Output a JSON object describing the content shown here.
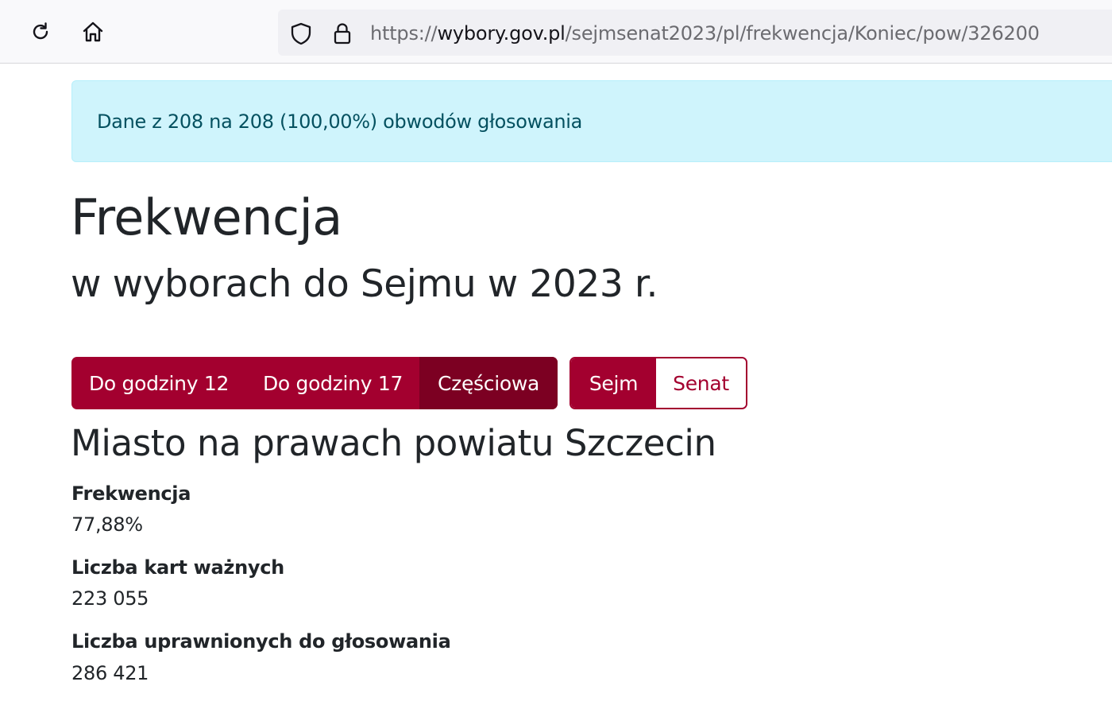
{
  "browser": {
    "url_prefix": "https://",
    "url_domain": "wybory.gov.pl",
    "url_path": "/sejmsenat2023/pl/frekwencja/Koniec/pow/326200",
    "icons": [
      "reload-icon",
      "home-icon",
      "shield-icon",
      "lock-icon"
    ]
  },
  "alert": {
    "text": "Dane z 208 na 208 (100,00%) obwodów głosowania"
  },
  "page": {
    "title": "Frekwencja",
    "subtitle": "w wyborach do Sejmu w 2023 r."
  },
  "time_buttons": [
    {
      "label": "Do godziny 12"
    },
    {
      "label": "Do godziny 17"
    },
    {
      "label": "Częściowa",
      "active": true
    }
  ],
  "chamber_buttons": [
    {
      "label": "Sejm",
      "active": true
    },
    {
      "label": "Senat"
    }
  ],
  "region": {
    "name": "Miasto na prawach powiatu Szczecin"
  },
  "stats": [
    {
      "label": "Frekwencja",
      "value": "77,88%"
    },
    {
      "label": "Liczba kart ważnych",
      "value": "223 055"
    },
    {
      "label": "Liczba uprawnionych do głosowania",
      "value": "286 421"
    }
  ],
  "colors": {
    "primary": "#a3002f",
    "primary_active": "#7c0022",
    "alert_bg": "#cff4fc",
    "alert_text": "#055160"
  }
}
